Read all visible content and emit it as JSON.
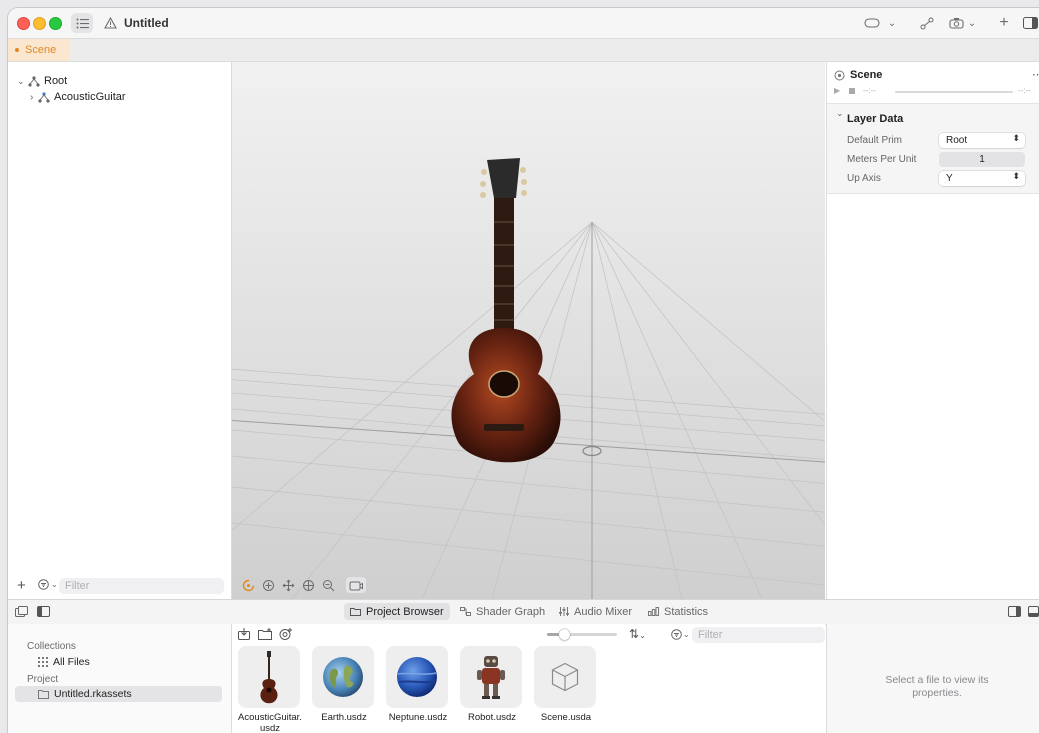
{
  "window": {
    "title": "Untitled"
  },
  "toolbar": {
    "icons": [
      "sidebar-list-icon",
      "warning-icon",
      "headset-icon",
      "chevron-down-icon",
      "share-icon",
      "camera-icon",
      "plus-icon",
      "inspector-toggle-icon"
    ]
  },
  "tabs": [
    {
      "label": "Scene",
      "active": true,
      "accent": "#e08a1e"
    }
  ],
  "outline": {
    "items": [
      {
        "label": "Root",
        "expanded": true,
        "depth": 0
      },
      {
        "label": "AcousticGuitar",
        "expanded": false,
        "depth": 1
      }
    ],
    "filter_placeholder": "Filter"
  },
  "viewport": {
    "tools": [
      "orbit-icon",
      "dolly-icon",
      "pan-icon",
      "focus-icon",
      "zoom-icon",
      "camera-view-icon"
    ],
    "active_tool": "orbit-icon"
  },
  "inspector": {
    "title": "Scene",
    "timecode_left": "--:--",
    "timecode_right": "--:--",
    "section_title": "Layer Data",
    "fields": [
      {
        "label": "Default Prim",
        "value": "Root",
        "type": "popup"
      },
      {
        "label": "Meters Per Unit",
        "value": "1",
        "type": "number"
      },
      {
        "label": "Up Axis",
        "value": "Y",
        "type": "popup"
      }
    ]
  },
  "bottom_tabs": [
    {
      "label": "Project Browser",
      "active": true
    },
    {
      "label": "Shader Graph",
      "active": false
    },
    {
      "label": "Audio Mixer",
      "active": false
    },
    {
      "label": "Statistics",
      "active": false
    }
  ],
  "collections": {
    "header": "Collections",
    "items": [
      {
        "label": "All Files"
      }
    ],
    "project_header": "Project",
    "project_items": [
      {
        "label": "Untitled.rkassets",
        "selected": true
      }
    ]
  },
  "browser": {
    "filter_placeholder": "Filter",
    "zoom_level": 0.2,
    "assets": [
      {
        "name": "AcousticGuitar.usdz",
        "kind": "guitar"
      },
      {
        "name": "Earth.usdz",
        "kind": "earth"
      },
      {
        "name": "Neptune.usdz",
        "kind": "neptune"
      },
      {
        "name": "Robot.usdz",
        "kind": "robot"
      },
      {
        "name": "Scene.usda",
        "kind": "scene"
      }
    ]
  },
  "properties": {
    "empty_message": "Select a file to view its properties."
  }
}
